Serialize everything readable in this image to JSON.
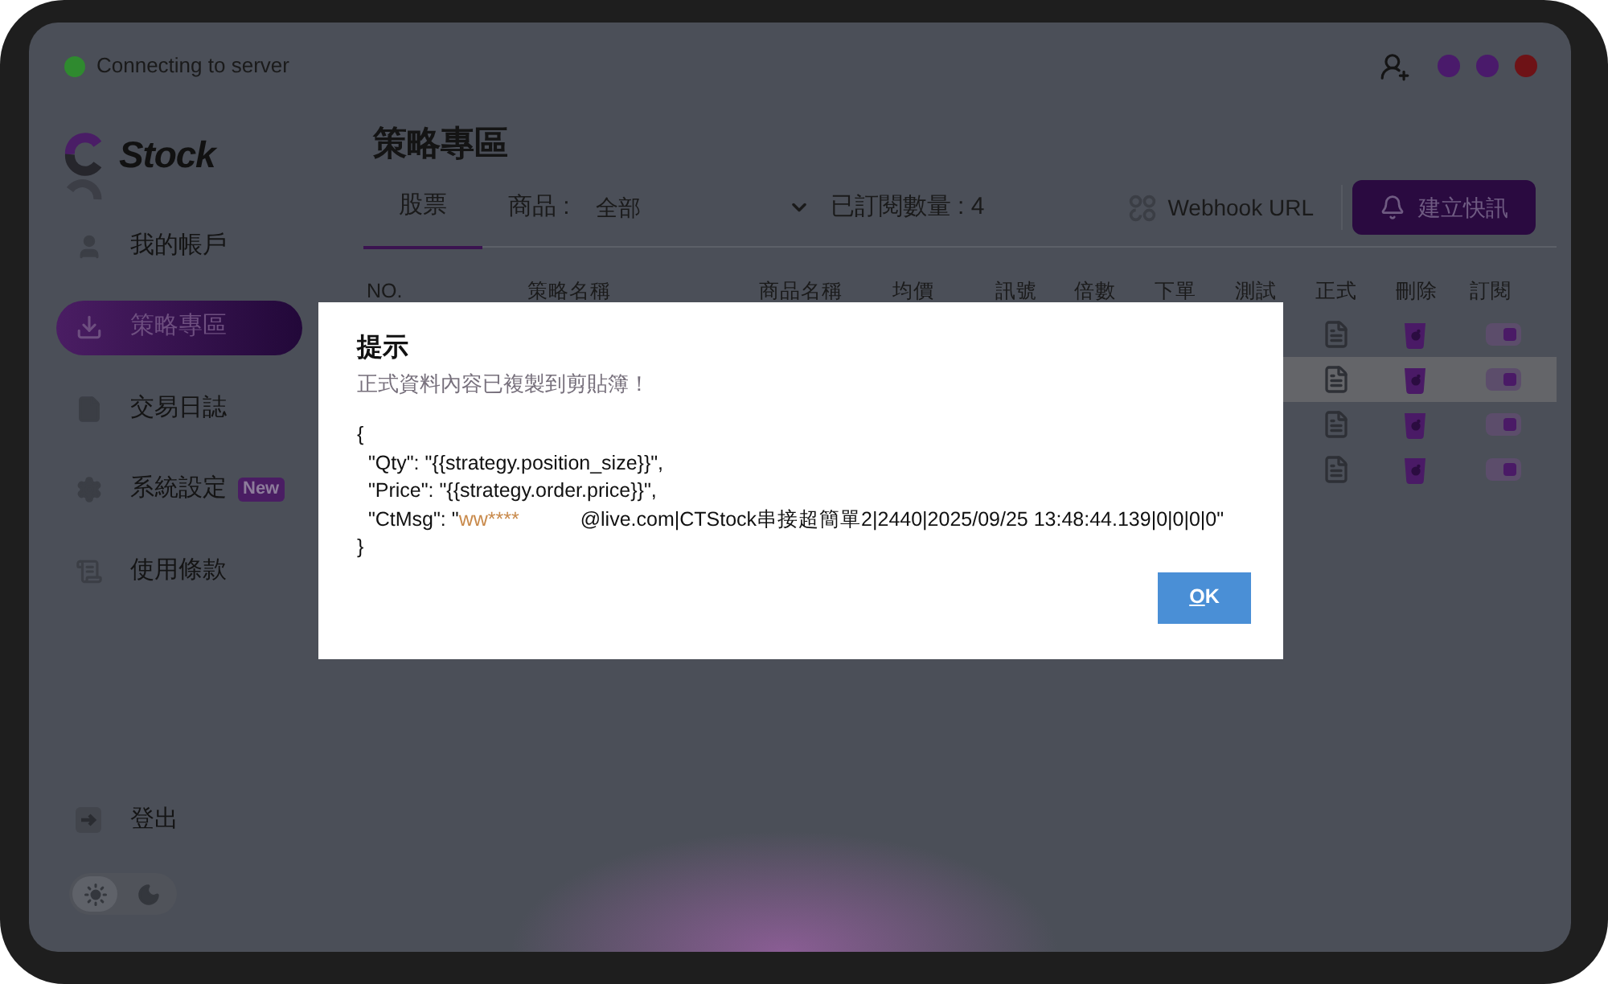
{
  "window": {
    "status": "Connecting to server",
    "controls": [
      {
        "color": "#4a1a6b"
      },
      {
        "color": "#4a1a6b"
      },
      {
        "color": "#6e1216"
      }
    ]
  },
  "logo": {
    "text": "Stock"
  },
  "sidebar": {
    "items": [
      {
        "kind": "account",
        "label": "我的帳戶",
        "selected": false
      },
      {
        "kind": "strategy",
        "label": "策略專區",
        "selected": true
      },
      {
        "kind": "log",
        "label": "交易日誌",
        "selected": false
      },
      {
        "kind": "settings",
        "label": "系統設定",
        "selected": false,
        "badge": "New"
      },
      {
        "kind": "terms",
        "label": "使用條款",
        "selected": false
      }
    ],
    "logout": {
      "label": "登出"
    },
    "theme": [
      {
        "kind": "light",
        "selected": true
      },
      {
        "kind": "dark",
        "selected": false
      }
    ]
  },
  "page": {
    "title": "策略專區",
    "tabs": [
      {
        "label": "股票",
        "selected": true
      }
    ],
    "product_filter": {
      "label": "商品 :",
      "value": "全部"
    },
    "subscribed_count": "已訂閱數量 : 4",
    "webhook_button": "Webhook URL",
    "create_alert_button": "建立快訊"
  },
  "table": {
    "columns": [
      "NO.",
      "策略名稱",
      "商品名稱",
      "均價",
      "訊號",
      "倍數",
      "下單",
      "測試",
      "正式",
      "刪除",
      "訂閱"
    ],
    "rows": [
      {
        "selected": false,
        "subscribed": true
      },
      {
        "selected": true,
        "subscribed": true
      },
      {
        "selected": false,
        "subscribed": true
      },
      {
        "selected": false,
        "subscribed": true
      }
    ]
  },
  "dialog": {
    "title": "提示",
    "message": "正式資料內容已複製到剪貼簿！",
    "code_lines": [
      {
        "kind": "plain",
        "text": "{"
      },
      {
        "kind": "plain",
        "text": "  \"Qty\": \"{{strategy.position_size}}\","
      },
      {
        "kind": "plain",
        "text": "  \"Price\": \"{{strategy.order.price}}\","
      },
      {
        "kind": "masked",
        "before": "  \"CtMsg\": \"",
        "masked": "ww****",
        "after": "@live.com|CTStock串接超簡單2|2440|2025/09/25 13:48:44.139|0|0|0|0\""
      },
      {
        "kind": "plain",
        "text": "}"
      }
    ],
    "ok_button": "OK"
  }
}
